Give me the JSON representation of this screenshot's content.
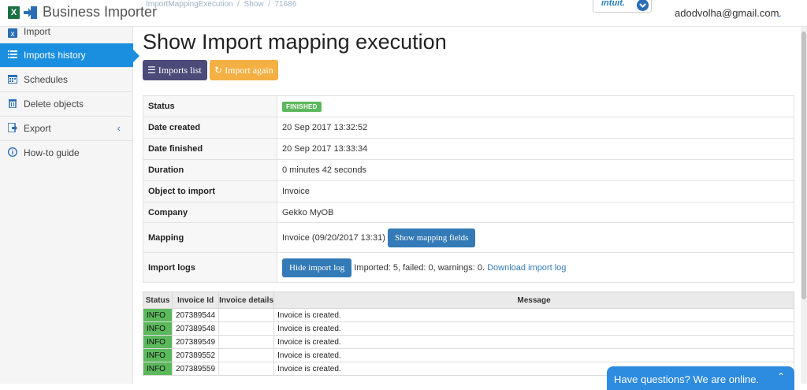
{
  "header": {
    "brand": "Business Importer",
    "breadcrumb": [
      "ImportMappingExecution",
      "Show",
      "71686"
    ],
    "intuit_label": "intuit.",
    "user_email": "adodvolha@gmail.com"
  },
  "sidebar": {
    "items": [
      {
        "label": "Import",
        "icon": "excel-icon"
      },
      {
        "label": "Imports history",
        "icon": "list-icon",
        "active": true
      },
      {
        "label": "Schedules",
        "icon": "calendar-icon"
      },
      {
        "label": "Delete objects",
        "icon": "trash-icon"
      },
      {
        "label": "Export",
        "icon": "export-icon"
      },
      {
        "label": "How-to guide",
        "icon": "info-icon"
      }
    ]
  },
  "page": {
    "title": "Show Import mapping execution",
    "btn_imports_list": "Imports list",
    "btn_import_again": "Import again"
  },
  "details": {
    "status_label": "Status",
    "status_value": "FINISHED",
    "created_label": "Date created",
    "created_value": "20 Sep 2017 13:32:52",
    "finished_label": "Date finished",
    "finished_value": "20 Sep 2017 13:33:34",
    "duration_label": "Duration",
    "duration_value": "0 minutes 42 seconds",
    "object_label": "Object to import",
    "object_value": "Invoice",
    "company_label": "Company",
    "company_value": "Gekko MyOB",
    "mapping_label": "Mapping",
    "mapping_value": "Invoice (09/20/2017 13:31)",
    "mapping_btn": "Show mapping fields",
    "logs_label": "Import logs",
    "logs_btn": "Hide import log",
    "logs_summary": "Imported: 5, failed: 0, warnings: 0.",
    "logs_link": "Download import log"
  },
  "logs_table": {
    "headers": [
      "Status",
      "Invoice Id",
      "Invoice details",
      "Message"
    ],
    "rows": [
      {
        "status": "INFO",
        "id": "207389544",
        "details": "",
        "message": "Invoice is created."
      },
      {
        "status": "INFO",
        "id": "207389548",
        "details": "",
        "message": "Invoice is created."
      },
      {
        "status": "INFO",
        "id": "207389549",
        "details": "",
        "message": "Invoice is created."
      },
      {
        "status": "INFO",
        "id": "207389552",
        "details": "",
        "message": "Invoice is created."
      },
      {
        "status": "INFO",
        "id": "207389559",
        "details": "",
        "message": "Invoice is created."
      }
    ]
  },
  "chat": {
    "text": "Have questions? We are online."
  },
  "colors": {
    "accent": "#1a8fe0",
    "success": "#5cb85c",
    "primary": "#337ab7",
    "warning": "#f4b042",
    "dark_button": "#4b4a78"
  }
}
